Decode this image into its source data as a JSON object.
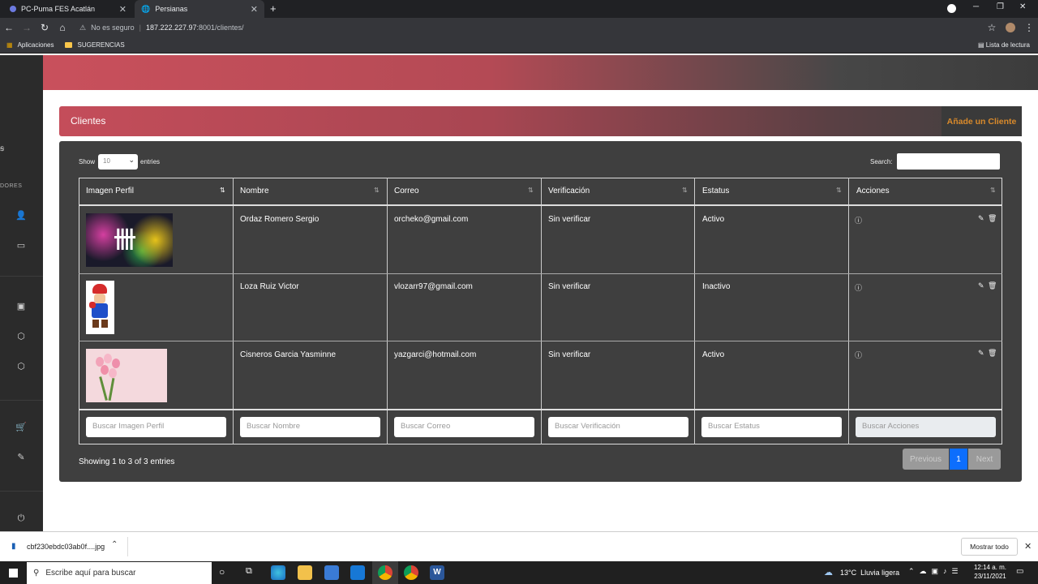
{
  "browser": {
    "tabs": [
      {
        "title": "PC-Puma FES Acatlán",
        "active": false
      },
      {
        "title": "Persianas",
        "active": true
      }
    ],
    "url_security": "No es seguro",
    "url_host": "187.222.227.97",
    "url_path": ":8001/clientes/",
    "bookmarks": {
      "apps": "Aplicaciones",
      "folder": "SUGERENCIAS",
      "reading_list": "Lista de lectura"
    }
  },
  "sidebar": {
    "section_label": "DORES"
  },
  "card": {
    "title": "Clientes",
    "add_button": "Añade un Cliente"
  },
  "table_controls": {
    "show_label": "Show",
    "length_value": "10",
    "entries_label": "entries",
    "search_label": "Search:"
  },
  "table": {
    "columns": [
      "Imagen Perfil",
      "Nombre",
      "Correo",
      "Verificación",
      "Estatus",
      "Acciones"
    ],
    "rows": [
      {
        "nombre": "Ordaz Romero Sergio",
        "correo": "orcheko@gmail.com",
        "verificacion": "Sin verificar",
        "estatus": "Activo"
      },
      {
        "nombre": "Loza Ruiz Victor",
        "correo": "vlozarr97@gmail.com",
        "verificacion": "Sin verificar",
        "estatus": "Inactivo"
      },
      {
        "nombre": "Cisneros Garcia Yasminne",
        "correo": "yazgarci@hotmail.com",
        "verificacion": "Sin verificar",
        "estatus": "Activo"
      }
    ],
    "filters": [
      "Buscar Imagen Perfil",
      "Buscar Nombre",
      "Buscar Correo",
      "Buscar Verificación",
      "Buscar Estatus",
      "Buscar Acciones"
    ]
  },
  "pagination": {
    "info": "Showing 1 to 3 of 3 entries",
    "previous": "Previous",
    "page": "1",
    "next": "Next"
  },
  "download": {
    "file": "cbf230ebdc03ab0f....jpg",
    "show_all": "Mostrar todo"
  },
  "taskbar": {
    "search_placeholder": "Escribe aquí para buscar",
    "weather": "13°C  Lluvia ligera",
    "time": "12:14 a. m.",
    "date": "23/11/2021"
  },
  "colors": {
    "accent": "#c9505c",
    "card_bg": "#3f3f3f",
    "add_button": "#d98a2b",
    "page_active": "#0d6efd"
  }
}
